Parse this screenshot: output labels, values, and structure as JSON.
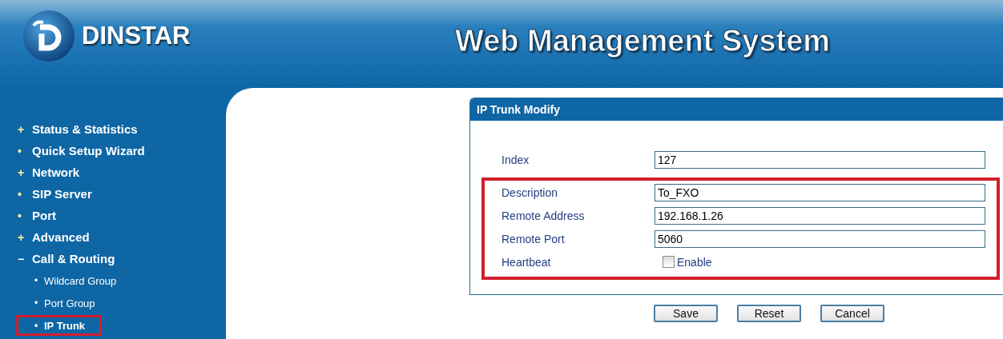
{
  "header": {
    "brand": "DINSTAR",
    "title": "Web Management System"
  },
  "sidebar": {
    "items": [
      {
        "marker": "+",
        "label": "Status & Statistics",
        "expanded": false
      },
      {
        "marker": "•",
        "label": "Quick Setup Wizard",
        "expanded": false
      },
      {
        "marker": "+",
        "label": "Network",
        "expanded": false
      },
      {
        "marker": "•",
        "label": "SIP Server",
        "expanded": false
      },
      {
        "marker": "•",
        "label": "Port",
        "expanded": false
      },
      {
        "marker": "+",
        "label": "Advanced",
        "expanded": false
      },
      {
        "marker": "−",
        "label": "Call & Routing",
        "expanded": true,
        "children": [
          {
            "marker": "•",
            "label": "Wildcard Group",
            "selected": false
          },
          {
            "marker": "•",
            "label": "Port Group",
            "selected": false
          },
          {
            "marker": "•",
            "label": "IP Trunk",
            "selected": true
          }
        ]
      }
    ]
  },
  "panel": {
    "title": "IP Trunk Modify",
    "rows": [
      {
        "kind": "text",
        "label": "Index",
        "value": "127",
        "highlighted": false
      },
      {
        "kind": "text",
        "label": "Description",
        "value": "To_FXO",
        "highlighted": true
      },
      {
        "kind": "text",
        "label": "Remote Address",
        "value": "192.168.1.26",
        "highlighted": true
      },
      {
        "kind": "text",
        "label": "Remote Port",
        "value": "5060",
        "highlighted": true
      },
      {
        "kind": "checkbox",
        "label": "Heartbeat",
        "option": "Enable",
        "checked": false,
        "highlighted": true
      }
    ]
  },
  "buttons": [
    "Save",
    "Reset",
    "Cancel"
  ]
}
